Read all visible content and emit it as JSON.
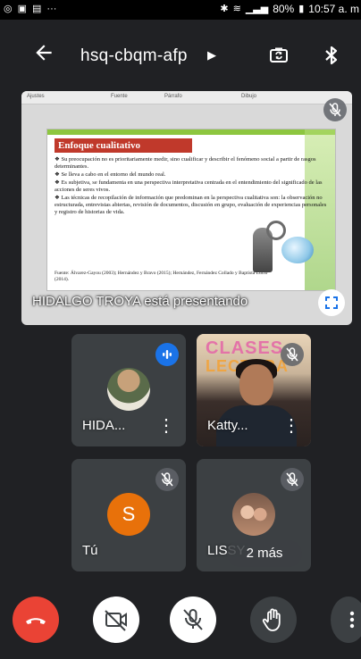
{
  "status_bar": {
    "left_icons": [
      "whatsapp-icon",
      "image-icon",
      "facebook-icon"
    ],
    "dots": "···",
    "battery": "80%",
    "time": "10:57 a. m"
  },
  "header": {
    "meeting_code": "hsq-cbqm-afp"
  },
  "presentation": {
    "ribbon": [
      "Ajustes",
      "Fuente",
      "Párrafo",
      "Dibujo"
    ],
    "slide_title": "Enfoque cualitativo",
    "slide_bullets": [
      "Su preocupación no es prioritariamente medir, sino cualificar y describir el fenómeno social a partir de rasgos determinantes.",
      "Se lleva a cabo en el entorno del mundo real.",
      "Es subjetiva, se fundamenta en una perspectiva interpretativa centrada en el entendimiento del significado de las acciones de seres vivos.",
      "Las técnicas de recopilación de información que predominan en la perspectiva cualitativa son: la observación no estructurada, entrevistas abiertas, revisión de documentos, discusión en grupo, evaluación de experiencias personales y registro de historias de vida."
    ],
    "slide_source": "Fuente: Álvarez-Gayou (2003); Hernández y Bravo (2015); Hernández, Fernández Collado y Baptista Lucio (2014).",
    "presenter_label": "HIDALGO TROYA está presentando"
  },
  "participants": [
    {
      "name": "HIDA...",
      "state": "speaking"
    },
    {
      "name": "Katty...",
      "state": "muted"
    },
    {
      "name": "Tú",
      "initial": "S",
      "state": "muted",
      "avatar_color": "#e8710a"
    },
    {
      "name": "LISSY",
      "state": "muted"
    }
  ],
  "overflow": {
    "label": "2 más"
  },
  "colors": {
    "background": "#202124",
    "tile": "#3c4043",
    "end_call": "#ea4335",
    "speaking": "#1a73e8"
  }
}
